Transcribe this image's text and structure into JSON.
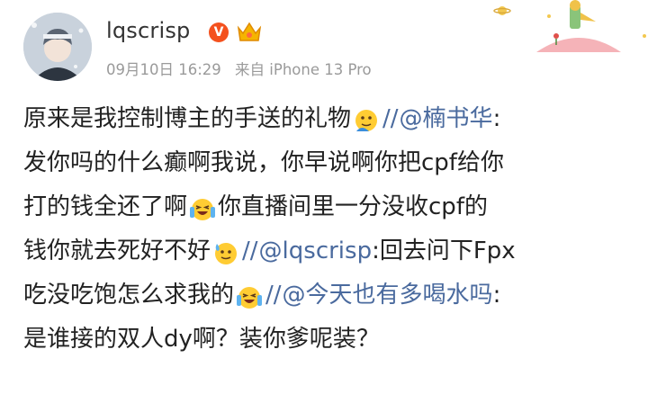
{
  "user": {
    "name": "lqscrisp",
    "verified_mark": "V",
    "timestamp": "09月10日 16:29",
    "source": "来自 iPhone 13 Pro"
  },
  "post": {
    "segments": {
      "l1a": "原来是我控制博主的手送的礼物",
      "sep1": "//",
      "m1": "@楠书华",
      "l1b": ":",
      "l2": "发你吗的什么癫啊我说，你早说啊你把cpf给你",
      "l3a": "打的钱全还了啊",
      "l3b": "你直播间里一分没收cpf的",
      "l4a": "钱你就去死好不好",
      "sep2": "//",
      "m2": "@lqscrisp",
      "l4b": ":回去问下Fpx",
      "l5a": "吃没吃饱怎么求我的",
      "sep3": "//",
      "m3": "@今天也有多喝水吗",
      "l5b": ":",
      "l6": "是谁接的双人dy啊？装你爹呢装？"
    }
  },
  "colors": {
    "mention": "#4a6a9e",
    "text": "#222222",
    "meta": "#9a9a9a",
    "verified": "#f4511e"
  },
  "icons": [
    "avatar",
    "verified-icon",
    "crown-icon",
    "little-prince-decoration",
    "thinking-emoji",
    "crying-laugh-emoji",
    "sweat-smile-emoji"
  ]
}
